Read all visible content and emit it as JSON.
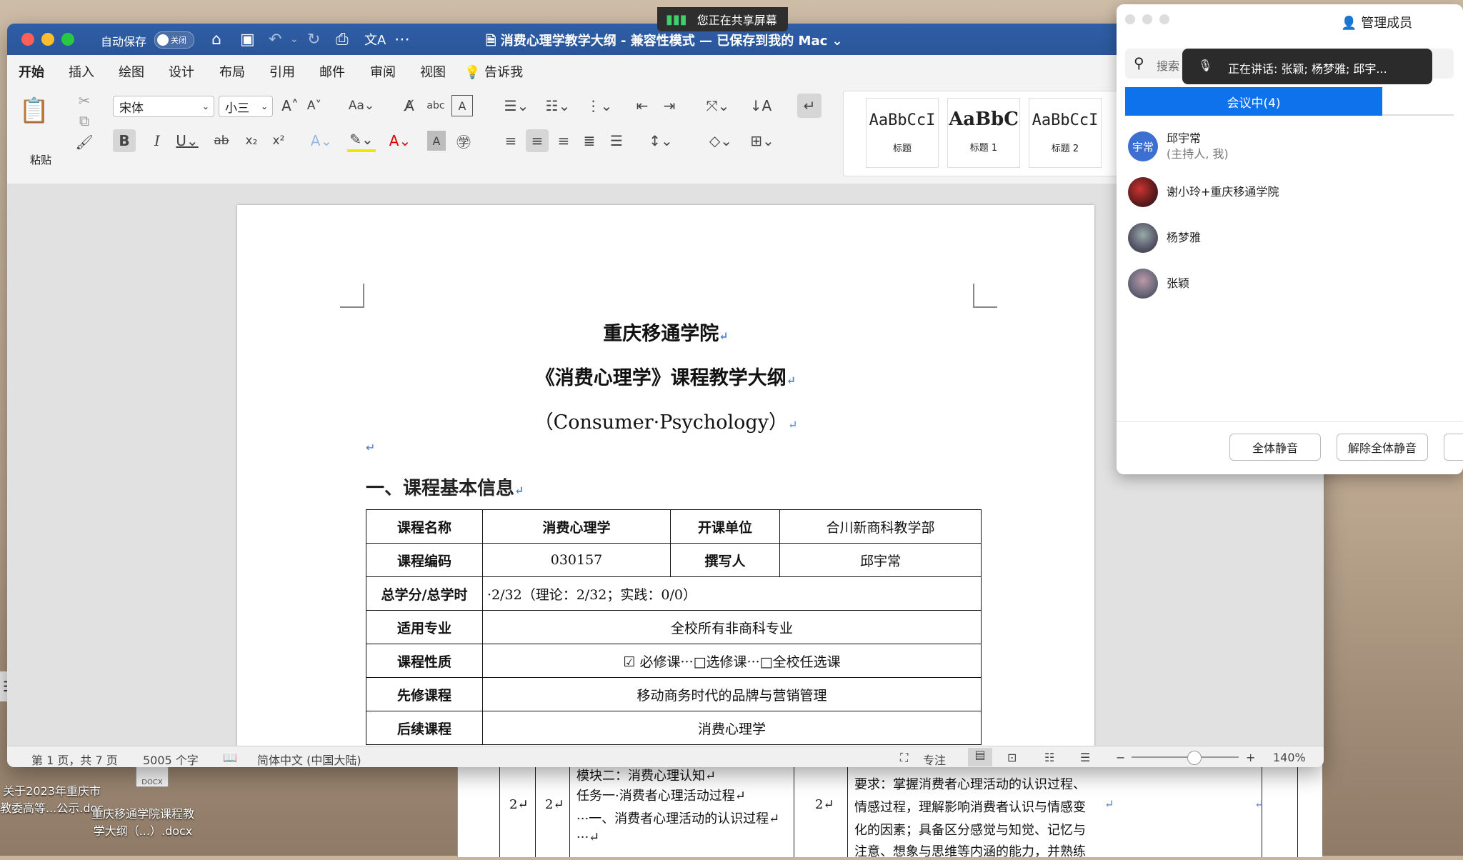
{
  "desktop": {
    "files": [
      {
        "label_lines": [
          "关于2023年重庆市",
          "教委高等...公示.doc"
        ]
      },
      {
        "label_lines": [
          "重庆移通学院课程教",
          "学大纲（...）.docx"
        ]
      }
    ],
    "file_icon_tag": "DOCX"
  },
  "background_doc": {
    "cells": {
      "col1": "2↵",
      "col2": "2↵",
      "module_lines": [
        "模块二：消费心理认知↵",
        "任务一·消费者心理活动过程↵",
        "···一、消费者心理活动的认识过程↵",
        "···↵"
      ],
      "col4": "2↵",
      "req_lines": [
        "要求：掌握消费者心理活动的认识过程、",
        "情感过程，理解影响消费者认识与情感变",
        "化的因素；具备区分感觉与知觉、记忆与",
        "注意、想象与思维等内涵的能力，并熟练"
      ],
      "col6": "↵",
      "col7": "↵"
    }
  },
  "share_banner": {
    "text": "您正在共享屏幕"
  },
  "word": {
    "autosave_label": "自动保存",
    "autosave_state": "关闭",
    "doc_title": "消费心理学教学大纲 - 兼容性模式 — 已保存到我的 Mac",
    "tabs": [
      "开始",
      "插入",
      "绘图",
      "设计",
      "布局",
      "引用",
      "邮件",
      "审阅",
      "视图"
    ],
    "tell_me": "告诉我",
    "paste_label": "粘贴",
    "font_name": "宋体",
    "font_size": "小三",
    "aa_label": "Aa",
    "styles": [
      {
        "preview": "AaBbCcI",
        "name": "标题"
      },
      {
        "preview": "AaBbC",
        "name": "标题 1"
      },
      {
        "preview": "AaBbCcI",
        "name": "标题 2"
      }
    ],
    "page": {
      "title1": "重庆移通学院",
      "title2": "《消费心理学》课程教学大纲",
      "title3": "（Consumer·Psychology）",
      "heading1": "一、课程基本信息",
      "return_mark": "↵",
      "table": {
        "course_name_label": "课程名称",
        "course_name": "消费心理学",
        "dept_label": "开课单位",
        "dept": "合川新商科教学部",
        "code_label": "课程编码",
        "code": "030157",
        "author_label": "撰写人",
        "author": "邱宇常",
        "credits_label": "总学分/总学时",
        "credits": "·2/32（理论：2/32；实践：0/0）",
        "major_label": "适用专业",
        "major": "全校所有非商科专业",
        "nature_label": "课程性质",
        "nature": "☑ 必修课···□选修课···□全校任选课",
        "prereq_label": "先修课程",
        "prereq": "移动商务时代的品牌与营销管理",
        "follow_label": "后续课程",
        "follow": "消费心理学"
      }
    },
    "status": {
      "page": "第 1 页，共 7 页",
      "words": "5005 个字",
      "language": "简体中文 (中国大陆)",
      "focus": "专注",
      "zoom": "140%",
      "zoom_level": 0.58
    }
  },
  "zoom_panel": {
    "title": "管理成员",
    "search_placeholder": "搜索",
    "speaking": "正在讲话:  张颖; 杨梦雅; 邱宇...",
    "tab_active": "会议中(4)",
    "participants": [
      {
        "name": "邱宇常",
        "sub": "(主持人, 我)",
        "avatar_text": "宇常"
      },
      {
        "name": "谢小玲+重庆移通学院",
        "sub": ""
      },
      {
        "name": "杨梦雅",
        "sub": ""
      },
      {
        "name": "张颖",
        "sub": ""
      }
    ],
    "mute_all": "全体静音",
    "unmute_all": "解除全体静音"
  },
  "colors": {
    "word_blue": "#2b579a",
    "zoom_blue": "#0e72ed"
  }
}
